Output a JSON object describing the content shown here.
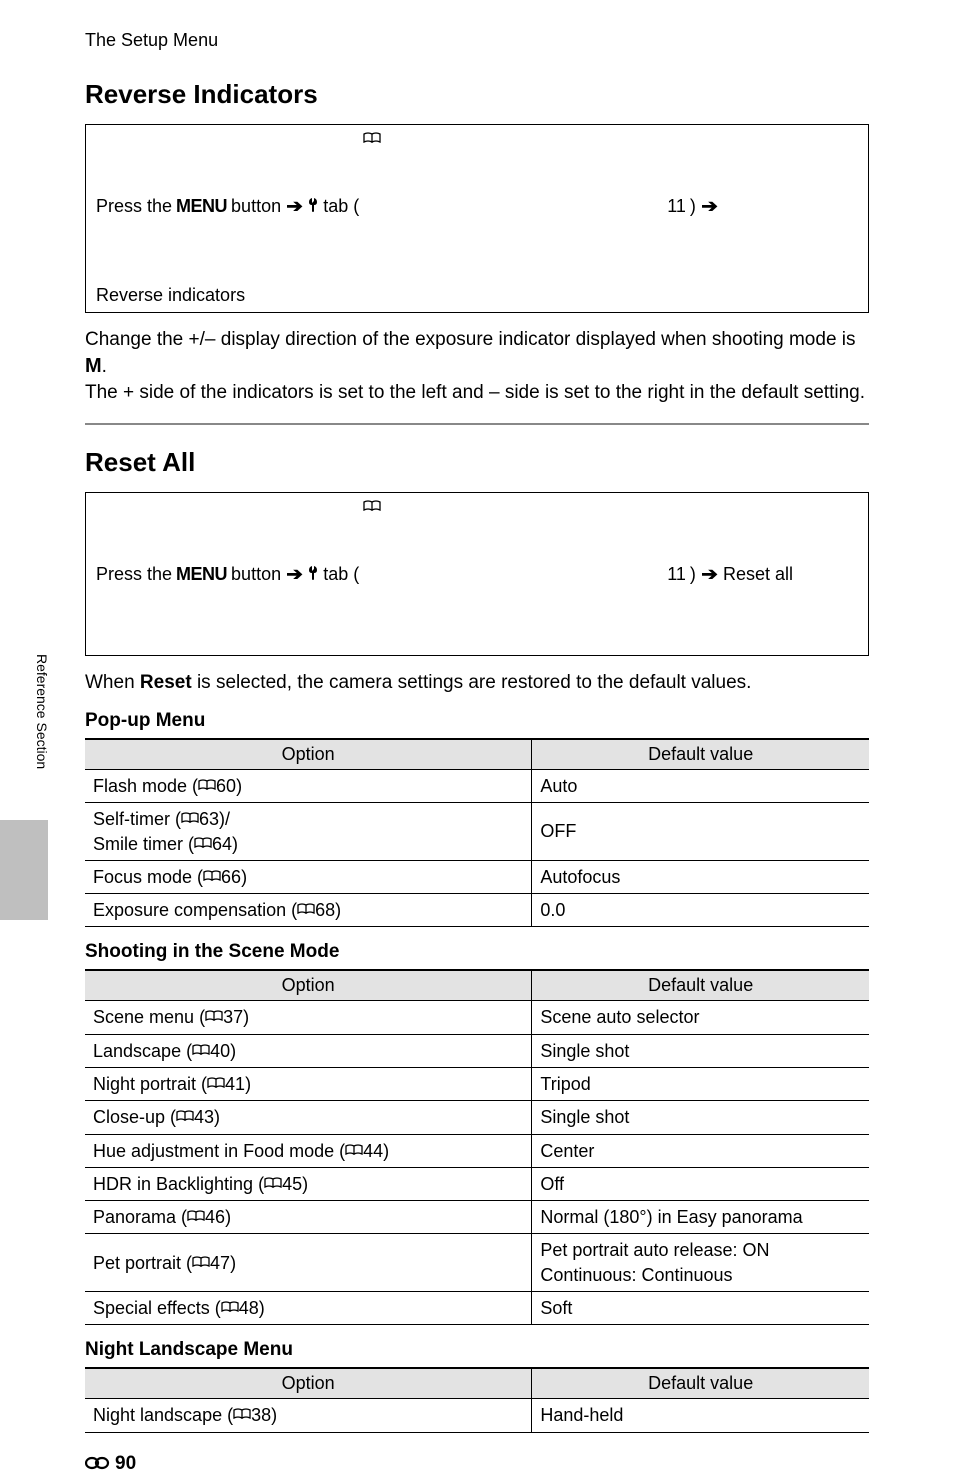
{
  "breadcrumb": "The Setup Menu",
  "reverse": {
    "title": "Reverse Indicators",
    "navPrefix": "Press the ",
    "navMenu": "MENU",
    "navButton": " button ",
    "navTab": " tab (",
    "navPageRef": "11",
    "navItem": "Reverse indicators",
    "bodyLine1a": "Change the +/– display direction of the exposure indicator displayed when shooting mode is ",
    "bodyLine1b": ".",
    "bodyLine2": "The + side of the indicators is set to the left and – side is set to the right in the default setting."
  },
  "resetAll": {
    "title": "Reset All",
    "navItem": "Reset all",
    "bodyPrefix": "When ",
    "bodyBold": "Reset",
    "bodySuffix": " is selected, the camera settings are restored to the default values."
  },
  "tableHeaders": {
    "option": "Option",
    "default": "Default value"
  },
  "popupMenu": {
    "heading": "Pop-up Menu",
    "rows": [
      {
        "opt": "Flash mode",
        "ref": "60",
        "def": "Auto"
      },
      {
        "opt": "Self-timer",
        "ref": "63",
        "opt2": "Smile timer",
        "ref2": "64",
        "sep": "/",
        "def": "OFF"
      },
      {
        "opt": "Focus mode",
        "ref": "66",
        "def": "Autofocus"
      },
      {
        "opt": "Exposure compensation",
        "ref": "68",
        "def": "0.0"
      }
    ]
  },
  "sceneMode": {
    "heading": "Shooting in the Scene Mode",
    "rows": [
      {
        "opt": "Scene menu",
        "ref": "37",
        "def": "Scene auto selector"
      },
      {
        "opt": "Landscape",
        "ref": "40",
        "def": "Single shot"
      },
      {
        "opt": "Night portrait",
        "ref": "41",
        "def": "Tripod"
      },
      {
        "opt": "Close-up",
        "ref": "43",
        "def": "Single shot"
      },
      {
        "opt": "Hue adjustment in Food mode",
        "ref": "44",
        "def": "Center"
      },
      {
        "opt": "HDR in Backlighting",
        "ref": "45",
        "def": "Off"
      },
      {
        "opt": "Panorama",
        "ref": "46",
        "def": "Normal (180°) in Easy panorama"
      },
      {
        "opt": "Pet portrait",
        "ref": "47",
        "def": "Pet portrait auto release: ON",
        "def2": "Continuous: Continuous"
      },
      {
        "opt": "Special effects",
        "ref": "48",
        "def": "Soft"
      }
    ]
  },
  "nightLandscape": {
    "heading": "Night Landscape Menu",
    "rows": [
      {
        "opt": "Night landscape",
        "ref": "38",
        "def": "Hand-held"
      }
    ]
  },
  "sideTab": "Reference Section",
  "pageNumber": "90"
}
